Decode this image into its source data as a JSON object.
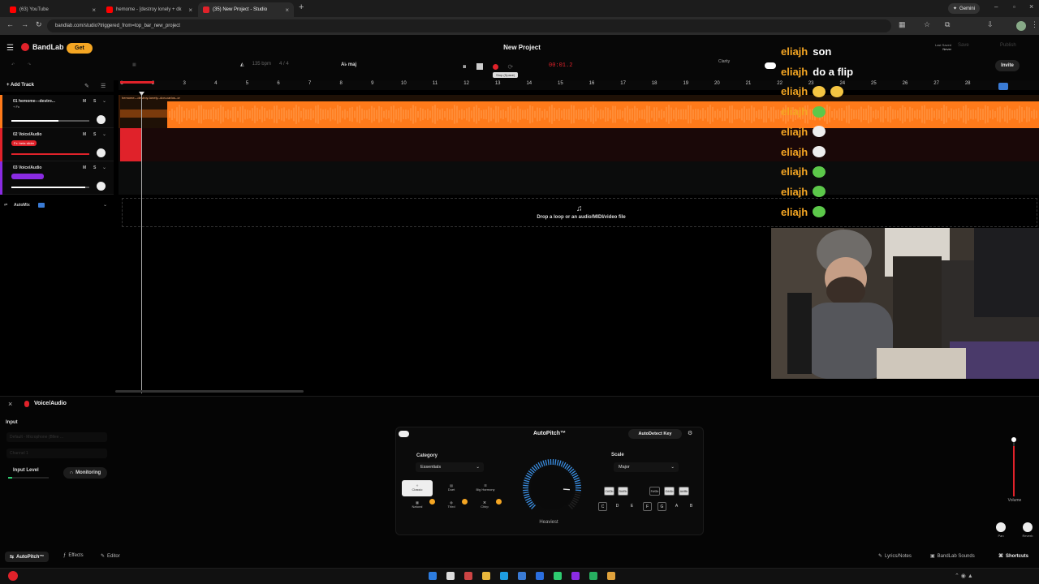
{
  "browser": {
    "tabs": [
      {
        "label": "(63) YouTube",
        "color": "#ff0000"
      },
      {
        "label": "hemome - [destroy lonely + dk",
        "color": "#ff0000"
      },
      {
        "label": "(35) New Project - Studio",
        "color": "#e0222a"
      }
    ],
    "url": "bandlab.com/studio?triggered_from=top_bar_new_project",
    "gemini_label": "Gemini"
  },
  "header": {
    "brand": "BandLab",
    "get_label": "Get",
    "project_title": "New Project",
    "tempo": "135 bpm",
    "time_signature": "4 / 4",
    "key_label": "A♭ maj",
    "timecode": "00:01.2",
    "tooltip": "Stop (Space)",
    "clarity_label": "Clarity",
    "last_saved_label": "Last Saved",
    "last_saved_value": "Never",
    "save_label": "Save",
    "publish_label": "Publish",
    "invite_label": "Invite"
  },
  "tracks": {
    "add_label": "Add Track",
    "items": [
      {
        "name": "01  hemome---destro...",
        "sub": "+ Fx",
        "m": "M",
        "s": "S",
        "color": "#ff7a1a",
        "volume": 0.6
      },
      {
        "name": "02  Voice/Audio",
        "fx": "Fx: beta slider",
        "m": "M",
        "s": "S",
        "color": "#e0222a",
        "volume": 0.95
      },
      {
        "name": "03  Voice/Audio",
        "fx": "",
        "m": "M",
        "s": "S",
        "color": "#8a2be2",
        "volume": 0.95
      }
    ],
    "automix_label": "AutoMix"
  },
  "timeline": {
    "ruler": [
      "1",
      "2",
      "3",
      "4",
      "5",
      "6",
      "7",
      "8",
      "9",
      "10",
      "11",
      "12",
      "13",
      "14",
      "15",
      "16",
      "17",
      "18",
      "19",
      "20",
      "21",
      "22",
      "23",
      "24",
      "25",
      "26",
      "27",
      "28"
    ],
    "clip_label": "hemome---destroy-lonely--don-carlos--cr",
    "drop_text": "Drop a loop or an audio/MIDI/video file"
  },
  "chat": [
    {
      "user": "eliajh",
      "message": "son",
      "emote": ""
    },
    {
      "user": "eliajh",
      "message": "do a flip",
      "emote": ""
    },
    {
      "user": "eliajh",
      "message": "",
      "emote": "laughing-face-icon"
    },
    {
      "user": "eliajh",
      "message": "",
      "emote": "green-frog-icon"
    },
    {
      "user": "eliajh",
      "message": "",
      "emote": "skull-icon"
    },
    {
      "user": "eliajh",
      "message": "",
      "emote": "skull-icon"
    },
    {
      "user": "eliajh",
      "message": "",
      "emote": "green-frog-icon"
    },
    {
      "user": "eliajh",
      "message": "",
      "emote": "green-frog-icon"
    },
    {
      "user": "eliajh",
      "message": "",
      "emote": "green-frog-icon"
    }
  ],
  "bottom_panel": {
    "track_name": "Voice/Audio",
    "input_label": "Input",
    "input_device": "Default - Microphone (Bllee ...",
    "channel": "Channel 1",
    "input_level_label": "Input Level",
    "monitoring_label": "Monitoring",
    "autopitch": {
      "title": "AutoPitch™",
      "autodetect_label": "AutoDetect Key",
      "category_label": "Category",
      "category_value": "Essentials",
      "scale_label": "Scale",
      "scale_value": "Major",
      "styles": [
        "Classic",
        "Duet",
        "Big Harmony",
        "Natural",
        "Third",
        "Chirp"
      ],
      "dial_label": "Heaviest",
      "dial_level": 0.85,
      "keys_sharp": [
        "C#/Db",
        "D#/Eb",
        "F#/Gb",
        "G#/Ab",
        "A#/Bb"
      ],
      "keys_natural": [
        "C",
        "D",
        "E",
        "F",
        "G",
        "A",
        "B"
      ],
      "active_keys": [
        "C",
        "F",
        "G",
        "G#/Ab",
        "A#/Bb",
        "C#/Db",
        "D#/Eb"
      ]
    },
    "volume_label": "Volume",
    "pan_label": "Pan",
    "reverb_label": "Reverb"
  },
  "footer": {
    "tabs": [
      "AutoPitch™",
      "Effects",
      "Editor"
    ],
    "right": [
      "Lyrics/Notes",
      "BandLab Sounds",
      "Shortcuts"
    ]
  },
  "colors": {
    "accent": "#e0222a",
    "clip_orange": "#ff7a1a",
    "chat_name": "#f5a623"
  }
}
